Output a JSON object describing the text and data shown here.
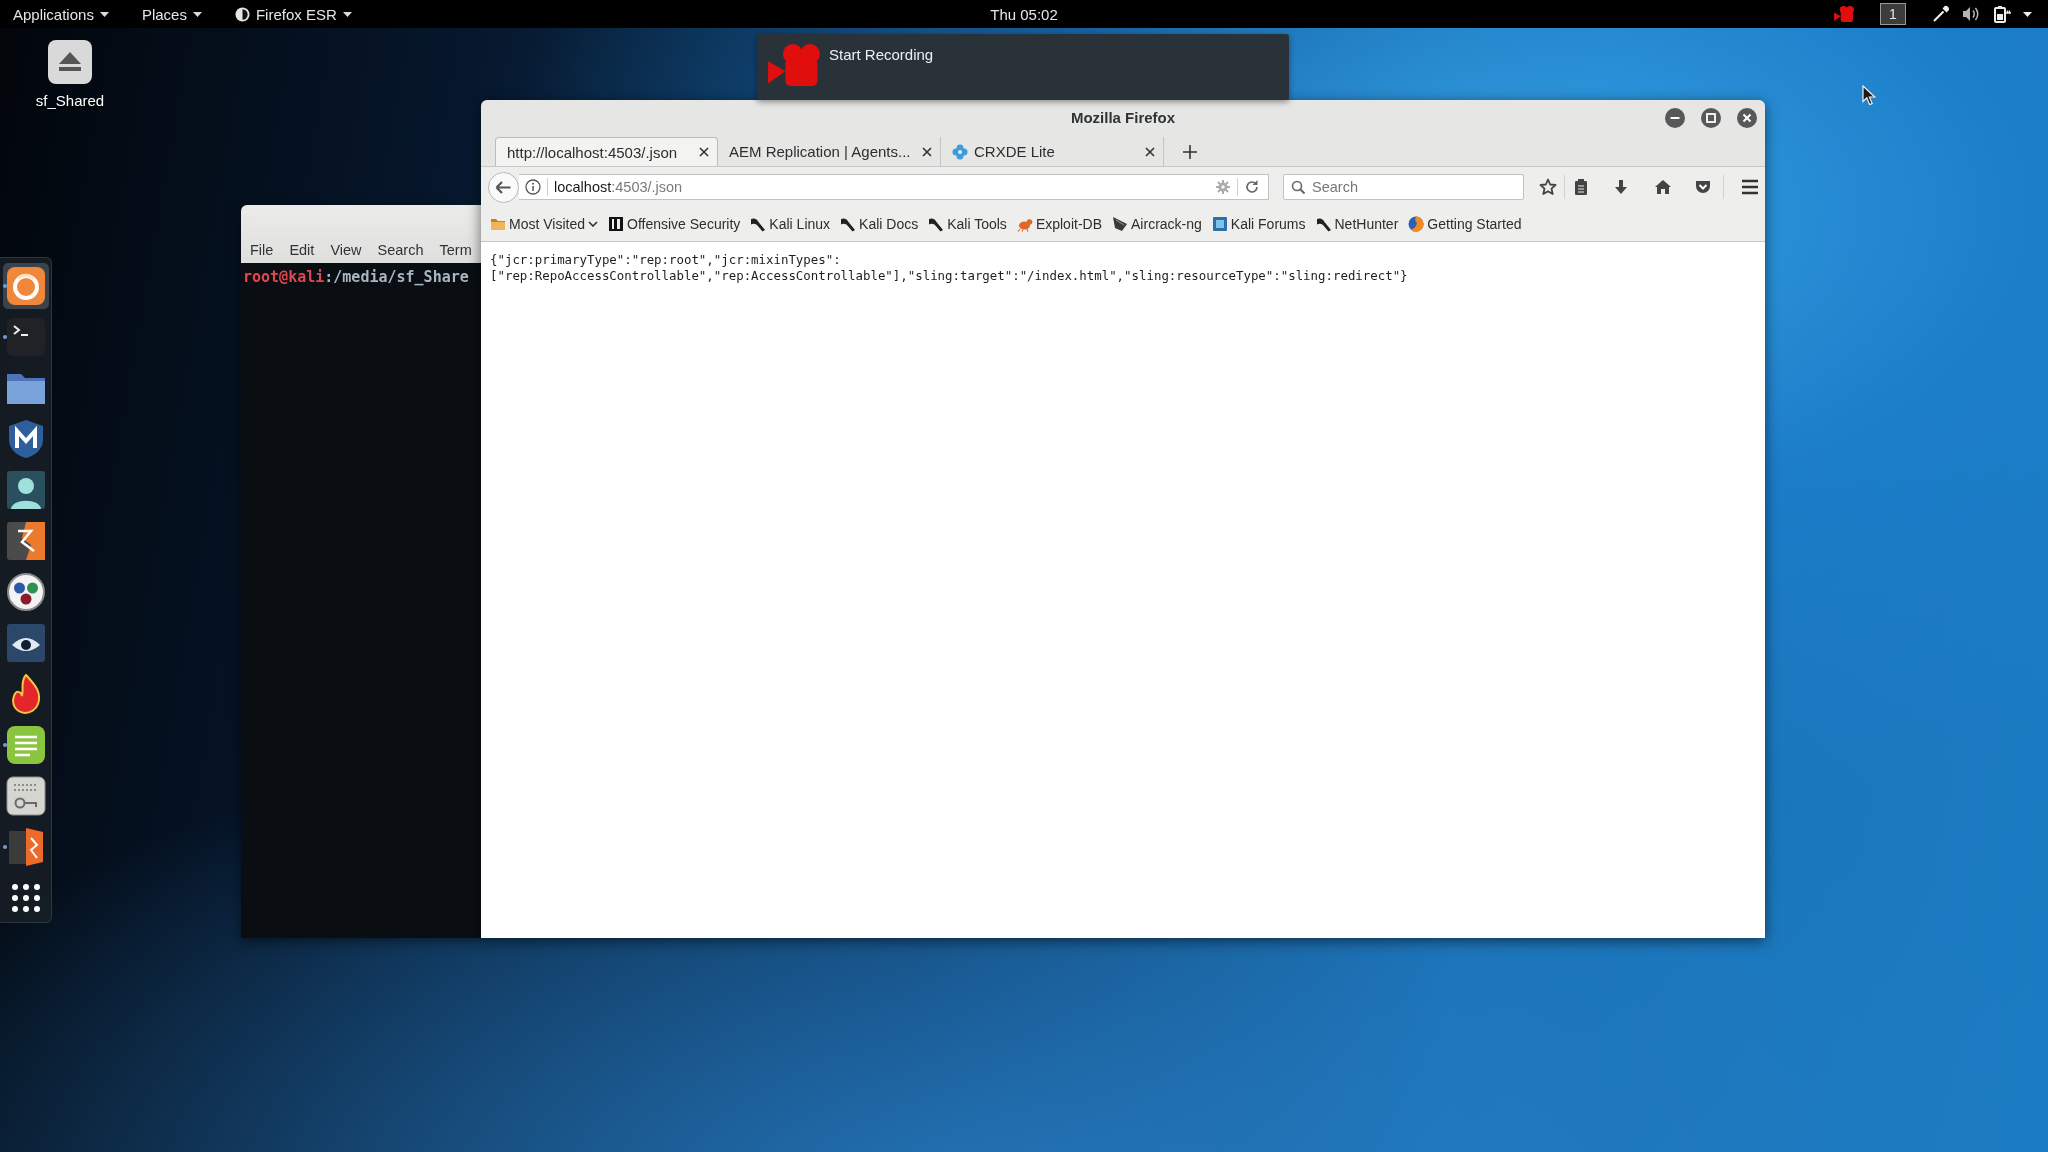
{
  "top_bar": {
    "menus": [
      {
        "label": "Applications",
        "icon": false
      },
      {
        "label": "Places",
        "icon": false
      },
      {
        "label": "Firefox ESR",
        "icon": true
      }
    ],
    "clock": "Thu 05:02",
    "workspace": "1"
  },
  "desktop_icons": [
    {
      "label": "sf_Shared"
    }
  ],
  "notification": {
    "title": "Start Recording"
  },
  "dock": {
    "items": [
      {
        "kind": "browser",
        "selected": true,
        "running": true
      },
      {
        "kind": "terminal",
        "selected": false,
        "running": true
      },
      {
        "kind": "folder",
        "selected": false,
        "running": false
      },
      {
        "kind": "shield",
        "selected": false,
        "running": false
      },
      {
        "kind": "person",
        "selected": false,
        "running": false
      },
      {
        "kind": "bolt",
        "selected": false,
        "running": false
      },
      {
        "kind": "circles",
        "selected": false,
        "running": false
      },
      {
        "kind": "eye",
        "selected": false,
        "running": false
      },
      {
        "kind": "flame",
        "selected": false,
        "running": false
      },
      {
        "kind": "notes",
        "selected": false,
        "running": true
      },
      {
        "kind": "panel",
        "selected": false,
        "running": false
      },
      {
        "kind": "door",
        "selected": false,
        "running": true
      },
      {
        "kind": "grid",
        "selected": false,
        "running": false
      }
    ]
  },
  "terminal": {
    "menu": [
      "File",
      "Edit",
      "View",
      "Search",
      "Term"
    ],
    "prompt": {
      "user": "root@kali",
      "path": ":/media/sf_Share"
    }
  },
  "browser": {
    "title": "Mozilla Firefox",
    "tabs": [
      {
        "label": "http://localhost:4503/.json",
        "selected": true,
        "icon": false
      },
      {
        "label": "AEM Replication | Agents...",
        "selected": false,
        "icon": false
      },
      {
        "label": "CRXDE Lite",
        "selected": false,
        "icon": true
      }
    ],
    "url": {
      "host": "localhost",
      "rest": ":4503/.json"
    },
    "search": {
      "placeholder": "Search"
    },
    "bookmarks": [
      {
        "label": "Most Visited",
        "kind": "folder"
      },
      {
        "label": "Offensive Security",
        "kind": "bars"
      },
      {
        "label": "Kali Linux",
        "kind": "dragon"
      },
      {
        "label": "Kali Docs",
        "kind": "dragon"
      },
      {
        "label": "Kali Tools",
        "kind": "dragon"
      },
      {
        "label": "Exploit-DB",
        "kind": "bug"
      },
      {
        "label": "Aircrack-ng",
        "kind": "wing"
      },
      {
        "label": "Kali Forums",
        "kind": "tile"
      },
      {
        "label": "NetHunter",
        "kind": "dragon"
      },
      {
        "label": "Getting Started",
        "kind": "globe"
      }
    ],
    "content": {
      "lines": [
        "{\"jcr:primaryType\":\"rep:root\",\"jcr:mixinTypes\":",
        "[\"rep:RepoAccessControllable\",\"rep:AccessControllable\"],\"sling:target\":\"/index.html\",\"sling:resourceType\":\"sling:redirect\"}"
      ]
    }
  }
}
